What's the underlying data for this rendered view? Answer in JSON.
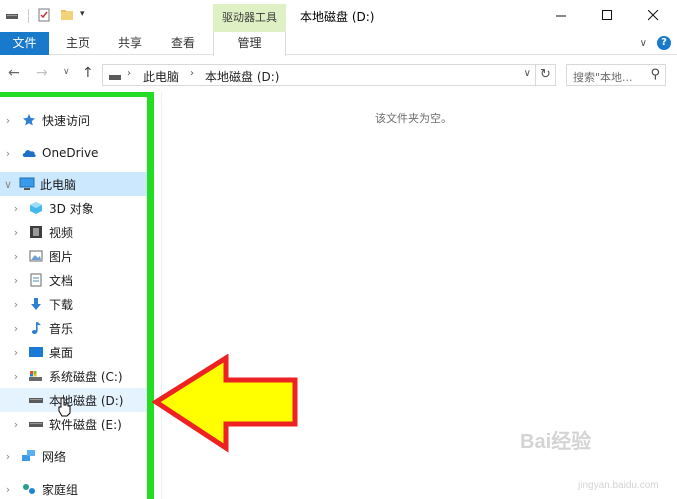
{
  "titlebar": {
    "context_tab_title": "驱动器工具",
    "window_title": "本地磁盘 (D:)"
  },
  "ribbon": {
    "tabs": [
      "文件",
      "主页",
      "共享",
      "查看",
      "管理"
    ]
  },
  "address": {
    "segments": [
      "此电脑",
      "本地磁盘 (D:)"
    ],
    "search_placeholder": "搜索\"本地..."
  },
  "navpane": {
    "items": [
      {
        "label": "快速访问",
        "icon": "star-icon"
      },
      {
        "label": "OneDrive",
        "icon": "cloud-icon"
      },
      {
        "label": "此电脑",
        "icon": "computer-icon"
      },
      {
        "label": "3D 对象",
        "icon": "cube-icon"
      },
      {
        "label": "视频",
        "icon": "film-icon"
      },
      {
        "label": "图片",
        "icon": "picture-icon"
      },
      {
        "label": "文档",
        "icon": "document-icon"
      },
      {
        "label": "下载",
        "icon": "download-icon"
      },
      {
        "label": "音乐",
        "icon": "music-icon"
      },
      {
        "label": "桌面",
        "icon": "desktop-icon"
      },
      {
        "label": "系统磁盘 (C:)",
        "icon": "system-drive-icon"
      },
      {
        "label": "本地磁盘 (D:)",
        "icon": "drive-icon"
      },
      {
        "label": "软件磁盘 (E:)",
        "icon": "drive-icon"
      },
      {
        "label": "网络",
        "icon": "network-icon"
      },
      {
        "label": "家庭组",
        "icon": "homegroup-icon"
      }
    ]
  },
  "content": {
    "empty_message": "该文件夹为空。"
  },
  "colors": {
    "ribbon_file_tab": "#1979ca",
    "context_tab": "#dff0c4",
    "selection": "#cce8ff",
    "annotation_green": "#22dd22",
    "annotation_arrow_fill": "#ffff00",
    "annotation_arrow_stroke": "#ee2222"
  },
  "watermark": {
    "brand": "Bai经验",
    "url": "jingyan.baidu.com"
  }
}
